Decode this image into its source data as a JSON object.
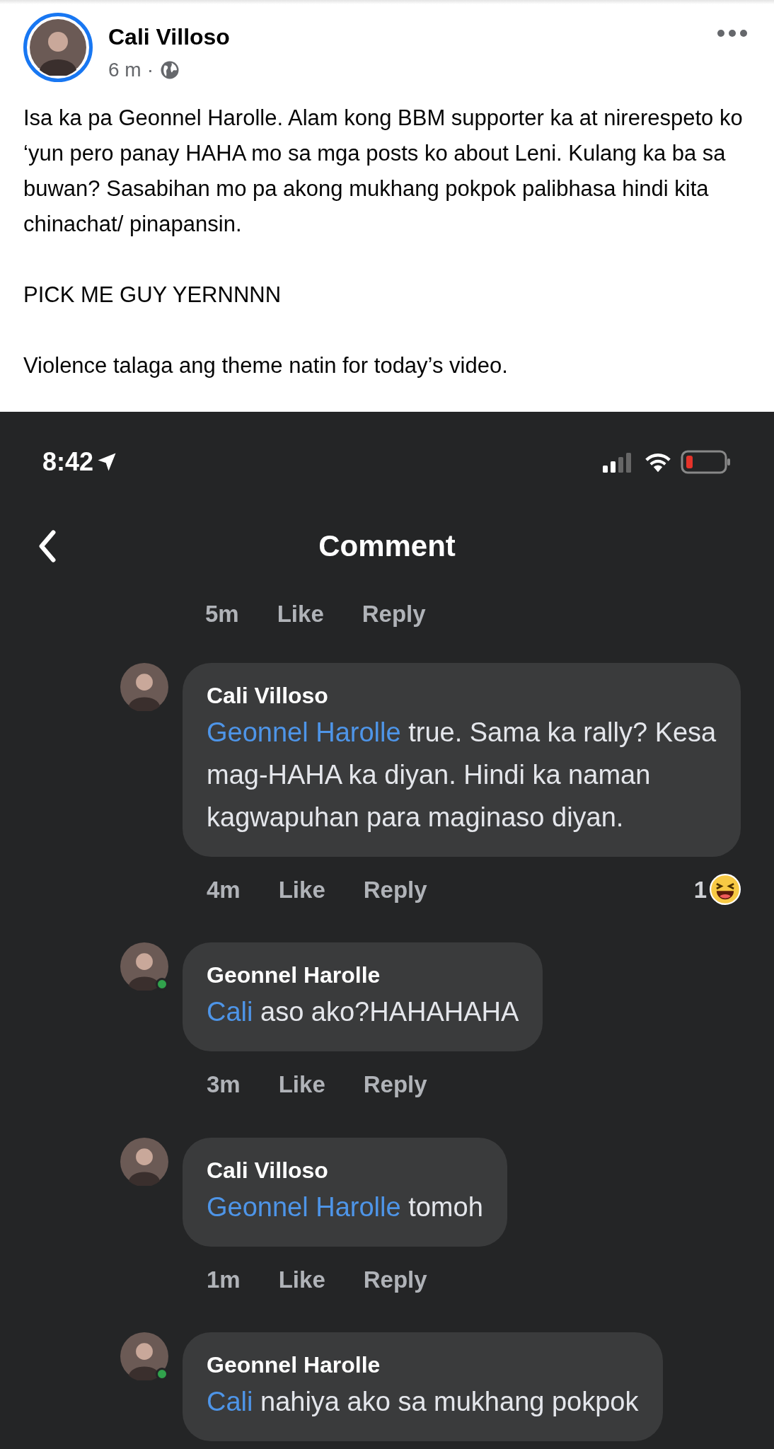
{
  "post": {
    "author": "Cali Villoso",
    "time": "6 m",
    "separator": "·",
    "paragraphs": [
      "Isa ka pa Geonnel Harolle. Alam kong BBM supporter ka at nirerespeto ko ‘yun pero panay HAHA mo sa mga posts ko about Leni. Kulang ka ba sa buwan? Sasabihan mo pa akong mukhang pokpok palibhasa hindi kita chinachat/ pinapansin.",
      "PICK ME GUY YERNNNN",
      "Violence talaga ang theme natin for today’s video."
    ]
  },
  "screenshot": {
    "status_time": "8:42",
    "title": "Comment",
    "top_meta": {
      "time": "5m",
      "like": "Like",
      "reply": "Reply"
    },
    "comments": [
      {
        "author": "Cali Villoso",
        "online": false,
        "mention": "Geonnel Harolle",
        "text": " true. Sama ka rally? Kesa mag-HAHA ka diyan. Hindi ka naman kagwapuhan para maginaso diyan.",
        "time": "4m",
        "like": "Like",
        "reply": "Reply",
        "reaction_count": "1"
      },
      {
        "author": "Geonnel Harolle",
        "online": true,
        "mention": "Cali",
        "text": " aso ako?HAHAHAHA",
        "time": "3m",
        "like": "Like",
        "reply": "Reply"
      },
      {
        "author": "Cali Villoso",
        "online": false,
        "mention": "Geonnel Harolle",
        "text": " tomoh",
        "time": "1m",
        "like": "Like",
        "reply": "Reply"
      },
      {
        "author": "Geonnel Harolle",
        "online": true,
        "mention": "Cali",
        "text": " nahiya ako sa mukhang pokpok"
      }
    ]
  }
}
